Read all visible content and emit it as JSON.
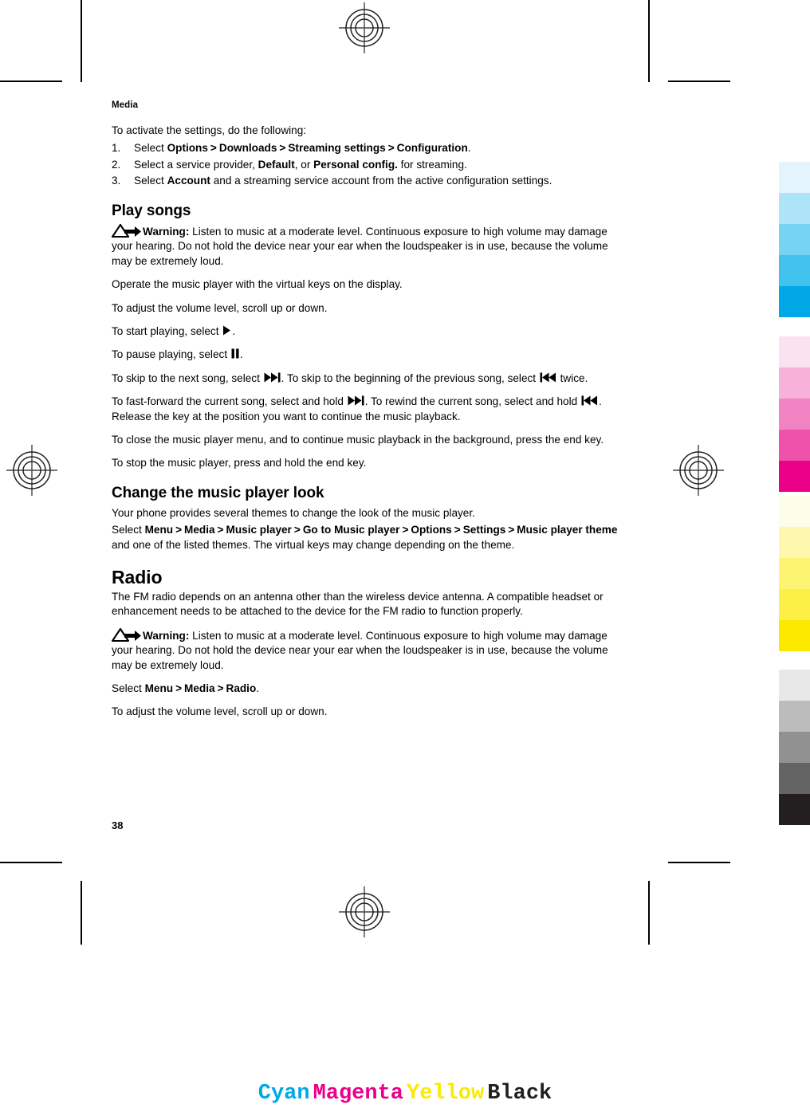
{
  "document": {
    "running_head": "Media",
    "page_number": "38"
  },
  "content": {
    "intro": "To activate the settings, do the following:",
    "steps": [
      {
        "num": "1.",
        "parts": [
          {
            "t": "Select ",
            "b": false
          },
          {
            "t": "Options",
            "b": true
          },
          {
            "t": ">",
            "gt": true
          },
          {
            "t": "Downloads",
            "b": true
          },
          {
            "t": ">",
            "gt": true
          },
          {
            "t": "Streaming settings",
            "b": true
          },
          {
            "t": ">",
            "gt": true
          },
          {
            "t": "Configuration",
            "b": true
          },
          {
            "t": ".",
            "b": false
          }
        ]
      },
      {
        "num": "2.",
        "parts": [
          {
            "t": "Select a service provider, ",
            "b": false
          },
          {
            "t": "Default",
            "b": true
          },
          {
            "t": ", or ",
            "b": false
          },
          {
            "t": "Personal config.",
            "b": true
          },
          {
            "t": " for streaming.",
            "b": false
          }
        ]
      },
      {
        "num": "3.",
        "parts": [
          {
            "t": "Select ",
            "b": false
          },
          {
            "t": "Account",
            "b": true
          },
          {
            "t": " and a streaming service account from the active configuration settings.",
            "b": false
          }
        ]
      }
    ],
    "play_songs_heading": "Play songs",
    "warning_label": "Warning:",
    "warning_text": " Listen to music at a moderate level. Continuous exposure to high volume may damage your hearing. Do not hold the device near your ear when the loudspeaker is in use, because the volume may be extremely loud.",
    "operate_text": "Operate the music player with the virtual keys on the display.",
    "volume_text": "To adjust the volume level, scroll up or down.",
    "start_playing_pre": "To start playing, select ",
    "start_playing_post": ".",
    "pause_playing_pre": "To pause playing, select ",
    "pause_playing_post": ".",
    "skip_pre": "To skip to the next song, select ",
    "skip_mid": ". To skip to the beginning of the previous song, select ",
    "skip_post": " twice.",
    "ff_pre": "To fast-forward the current song, select and hold ",
    "ff_mid": ". To rewind the current song, select and hold ",
    "ff_post": ". Release the key at the position you want to continue the music playback.",
    "close_text": "To close the music player menu, and to continue music playback in the background, press the end key.",
    "stop_text": "To stop the music player, press and hold the end key.",
    "change_look_heading": "Change the music player look",
    "change_look_text": "Your phone provides several themes to change the look of the music player.",
    "theme_path": [
      {
        "t": "Select ",
        "b": false
      },
      {
        "t": "Menu",
        "b": true
      },
      {
        "t": ">",
        "gt": true
      },
      {
        "t": "Media",
        "b": true
      },
      {
        "t": ">",
        "gt": true
      },
      {
        "t": "Music player",
        "b": true
      },
      {
        "t": ">",
        "gt": true
      },
      {
        "t": "Go to Music player",
        "b": true
      },
      {
        "t": ">",
        "gt": true
      },
      {
        "t": "Options",
        "b": true
      },
      {
        "t": ">",
        "gt": true
      },
      {
        "t": "Settings",
        "b": true
      },
      {
        "t": ">",
        "gt": true
      },
      {
        "t": "Music player theme",
        "b": true
      },
      {
        "t": " and one of the listed themes. The virtual keys may change depending on the theme.",
        "b": false
      }
    ],
    "radio_heading": "Radio",
    "radio_text": "The FM radio depends on an antenna other than the wireless device antenna. A compatible headset or enhancement needs to be attached to the device for the FM radio to function properly.",
    "radio_path": [
      {
        "t": "Select ",
        "b": false
      },
      {
        "t": "Menu",
        "b": true
      },
      {
        "t": ">",
        "gt": true
      },
      {
        "t": "Media",
        "b": true
      },
      {
        "t": ">",
        "gt": true
      },
      {
        "t": "Radio",
        "b": true
      },
      {
        "t": ".",
        "b": false
      }
    ],
    "radio_volume_text": "To adjust the volume level, scroll up or down."
  },
  "icons": {
    "warning": "warning-triangle-arrow-icon",
    "play": "play-icon",
    "pause": "pause-icon",
    "next": "skip-next-icon",
    "previous": "skip-previous-icon"
  },
  "print_marks": {
    "registration_target": "registration-target-icon",
    "crop_mark": "crop-mark"
  },
  "color_bar": {
    "cyan": [
      "#e4f4fd",
      "#aee4f8",
      "#76d3f4",
      "#41c3ee",
      "#00a8e8"
    ],
    "magenta": [
      "#fae2f0",
      "#f8b2da",
      "#f283c2",
      "#ee52ab",
      "#ea0089"
    ],
    "yellow": [
      "#fefde8",
      "#fdf8ad",
      "#fdf472",
      "#fcef45",
      "#fbea00"
    ],
    "black": [
      "#e8e8e8",
      "#bcbcbc",
      "#919191",
      "#646464",
      "#231f20"
    ]
  },
  "cmyk_caption": {
    "items": [
      {
        "label": "Cyan",
        "color": "#00a8e8"
      },
      {
        "label": "Magenta",
        "color": "#ea0089"
      },
      {
        "label": "Yellow",
        "color": "#fbea00"
      },
      {
        "label": "Black",
        "color": "#231f20"
      }
    ]
  }
}
